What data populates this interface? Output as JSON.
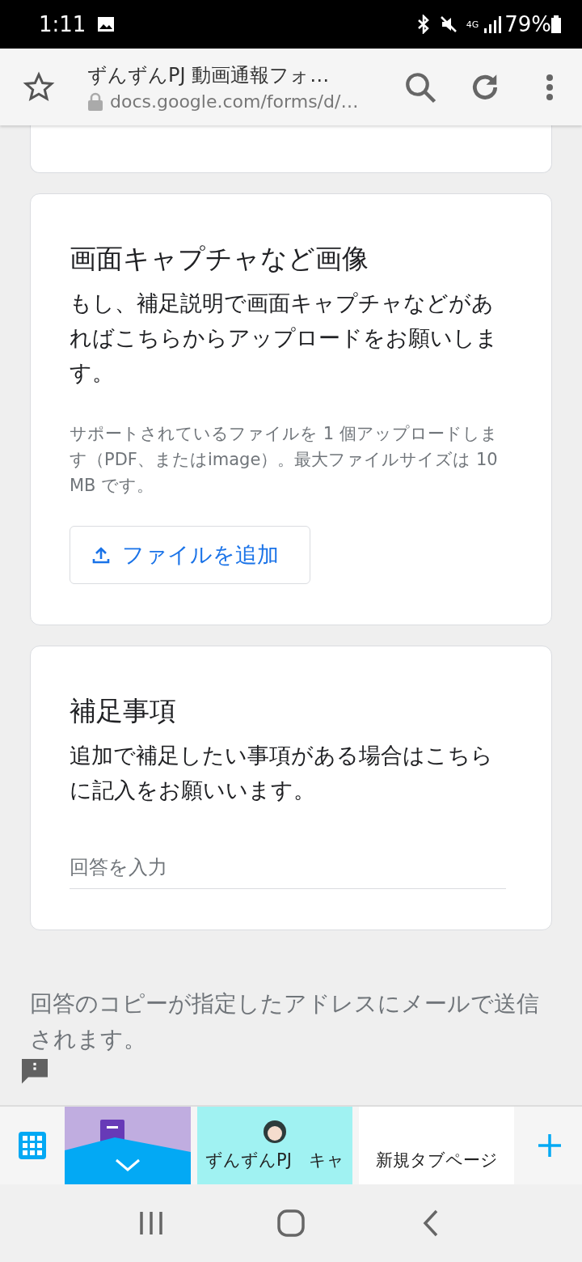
{
  "status_bar": {
    "time": "1:11",
    "battery": "79%",
    "network": "4G"
  },
  "browser_toolbar": {
    "title": "ずんずんPJ 動画通報フォ…",
    "url": "docs.google.com/forms/d/…"
  },
  "cards": [
    {
      "kind": "partial"
    },
    {
      "kind": "upload",
      "title": "画面キャプチャなど画像",
      "description": "もし、補足説明で画面キャプチャなどがあればこちらからアップロードをお願いします。",
      "help": "サポートされているファイルを 1 個アップロードします（PDF、またはimage）。最大ファイルサイズは 10 MB です。",
      "button": "ファイルを追加"
    },
    {
      "kind": "text",
      "title": "補足事項",
      "description": "追加で補足したい事項がある場合はこちらに記入をお願いいます。",
      "placeholder": "回答を入力"
    }
  ],
  "footer_note": "回答のコピーが指定したアドレスにメールで送信されます。",
  "tab_strip": {
    "tabs": [
      {
        "kind": "forms"
      },
      {
        "kind": "avatar",
        "label": "ずんずんPJ　キャ"
      },
      {
        "kind": "plain",
        "label": "新規タブページ"
      }
    ]
  }
}
